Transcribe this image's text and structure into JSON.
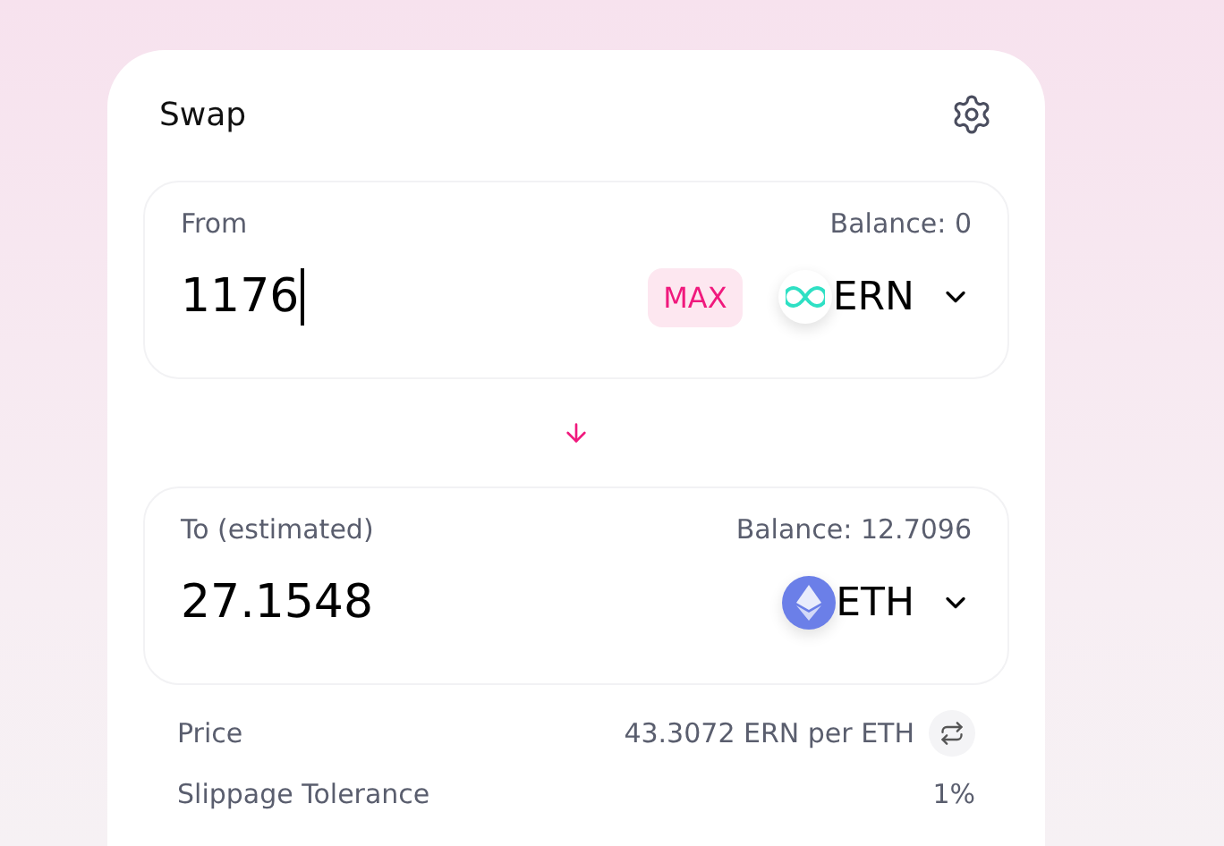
{
  "title": "Swap",
  "panels": [
    {
      "focused": true,
      "label": "From",
      "balance": "Balance: 0",
      "amount": "1176",
      "max_label": "MAX",
      "token": {
        "symbol": "ERN",
        "kind": "ern"
      }
    },
    {
      "focused": false,
      "label": "To (estimated)",
      "balance": "Balance: 12.7096",
      "amount": "27.1548",
      "token": {
        "symbol": "ETH",
        "kind": "eth"
      }
    }
  ],
  "details": [
    {
      "kind": "price",
      "label": "Price",
      "value": "43.3072 ERN per ETH"
    },
    {
      "kind": "plain",
      "label": "Slippage Tolerance",
      "value": "1%"
    }
  ]
}
